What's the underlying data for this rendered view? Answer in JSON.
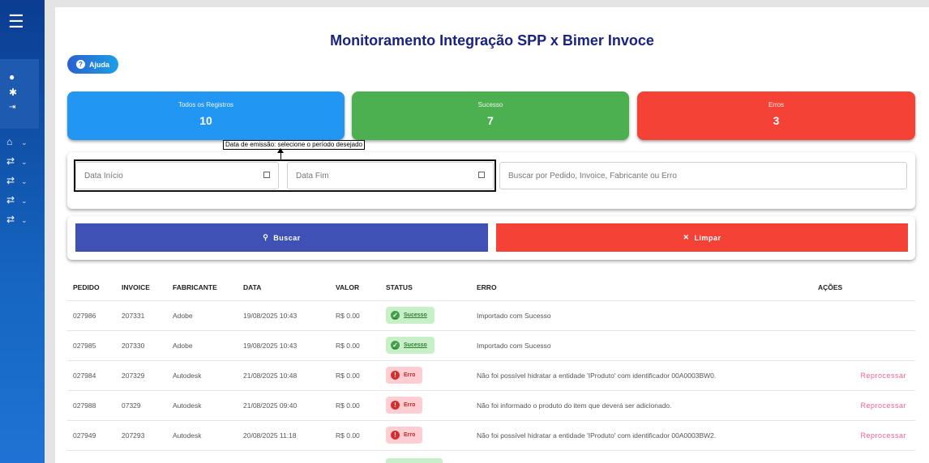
{
  "sidebar": {
    "menu_icon": "hamburger-icon",
    "icons": [
      "user-icon",
      "gear-icon",
      "logout-icon",
      "home-icon",
      "swap-icon",
      "swap-icon",
      "swap-icon",
      "swap-icon"
    ]
  },
  "page": {
    "title": "Monitoramento Integração SPP x Bimer Invoce",
    "help_label": "Ajuda"
  },
  "cards": {
    "all": {
      "label": "Todos os Registros",
      "value": "10"
    },
    "success": {
      "label": "Sucesso",
      "value": "7"
    },
    "errors": {
      "label": "Erros",
      "value": "3"
    }
  },
  "tooltip": "Data de emissão: selecione o período desejado",
  "filters": {
    "start_placeholder": "Data Início",
    "end_placeholder": "Data Fim",
    "search_placeholder": "Buscar por Pedido, Invoice, Fabricante ou Erro"
  },
  "actions": {
    "search_label": "Buscar",
    "clear_label": "Limpar"
  },
  "table": {
    "headers": [
      "PEDIDO",
      "INVOICE",
      "FABRICANTE",
      "DATA",
      "VALOR",
      "STATUS",
      "ERRO",
      "AÇÕES"
    ],
    "rows": [
      {
        "pedido": "027986",
        "invoice": "207331",
        "fabricante": "Adobe",
        "data": "19/08/2025 10:43",
        "valor": "R$ 0.00",
        "status": "Sucesso",
        "erro": "Importado com Sucesso",
        "acao": ""
      },
      {
        "pedido": "027985",
        "invoice": "207330",
        "fabricante": "Adobe",
        "data": "19/08/2025 10:43",
        "valor": "R$ 0.00",
        "status": "Sucesso",
        "erro": "Importado com Sucesso",
        "acao": ""
      },
      {
        "pedido": "027984",
        "invoice": "207329",
        "fabricante": "Autodesk",
        "data": "21/08/2025 10:48",
        "valor": "R$ 0.00",
        "status": "Erro",
        "erro": "Não foi possível hidratar a entidade 'IProduto' com identificador 00A0003BW0.",
        "acao": "Reprocessar"
      },
      {
        "pedido": "027988",
        "invoice": "07329",
        "fabricante": "Autodesk",
        "data": "21/08/2025 09:40",
        "valor": "R$ 0.00",
        "status": "Erro",
        "erro": "Não foi informado o produto do item que deverá ser adicionado.",
        "acao": "Reprocessar"
      },
      {
        "pedido": "027949",
        "invoice": "207293",
        "fabricante": "Autodesk",
        "data": "20/08/2025 11:18",
        "valor": "R$ 0.00",
        "status": "Erro",
        "erro": "Não foi possível hidratar a entidade 'IProduto' com identificador 00A0003BW2.",
        "acao": "Reprocessar"
      }
    ]
  }
}
